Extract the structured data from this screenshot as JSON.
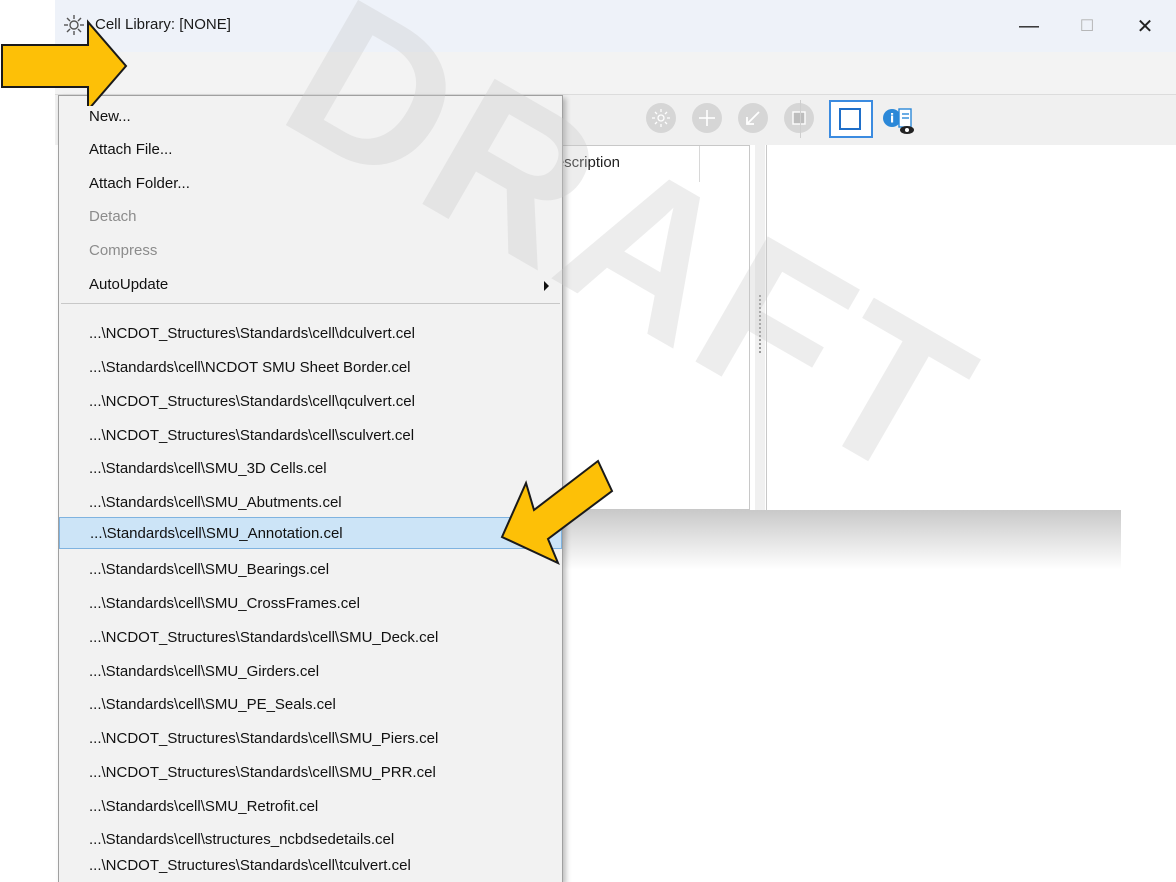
{
  "window": {
    "title": "Cell Library: [NONE]",
    "controls": {
      "minimize": "—",
      "maximize": "☐",
      "close": "✕"
    }
  },
  "table": {
    "column_description": "Description"
  },
  "menu": {
    "items": [
      {
        "label": "New...",
        "state": "enabled"
      },
      {
        "label": "Attach File...",
        "state": "enabled"
      },
      {
        "label": "Attach Folder...",
        "state": "enabled"
      },
      {
        "label": "Detach",
        "state": "disabled"
      },
      {
        "label": "Compress",
        "state": "disabled"
      },
      {
        "label": "AutoUpdate",
        "state": "submenu"
      }
    ],
    "recent_files": [
      "...\\NCDOT_Structures\\Standards\\cell\\dculvert.cel",
      "...\\Standards\\cell\\NCDOT SMU Sheet Border.cel",
      "...\\NCDOT_Structures\\Standards\\cell\\qculvert.cel",
      "...\\NCDOT_Structures\\Standards\\cell\\sculvert.cel",
      "...\\Standards\\cell\\SMU_3D Cells.cel",
      "...\\Standards\\cell\\SMU_Abutments.cel",
      "...\\Standards\\cell\\SMU_Annotation.cel",
      "...\\Standards\\cell\\SMU_Bearings.cel",
      "...\\Standards\\cell\\SMU_CrossFrames.cel",
      "...\\NCDOT_Structures\\Standards\\cell\\SMU_Deck.cel",
      "...\\Standards\\cell\\SMU_Girders.cel",
      "...\\Standards\\cell\\SMU_PE_Seals.cel",
      "...\\NCDOT_Structures\\Standards\\cell\\SMU_Piers.cel",
      "...\\NCDOT_Structures\\Standards\\cell\\SMU_PRR.cel",
      "...\\Standards\\cell\\SMU_Retrofit.cel",
      "...\\Standards\\cell\\structures_ncbdsedetails.cel",
      "...\\NCDOT_Structures\\Standards\\cell\\tculvert.cel"
    ],
    "selected_file": "...\\Standards\\cell\\SMU_Annotation.cel"
  },
  "watermark": "DRAFT",
  "colors": {
    "callout_fill": "#FDC007",
    "callout_stroke": "#1A1A1A",
    "selection_bg": "#CCE4F7",
    "active_border": "#3B8BE0"
  },
  "icons": [
    "sun-icon",
    "target-icon",
    "arrow-icon",
    "image-icon",
    "preview-pane-icon",
    "info-eye-icon"
  ]
}
